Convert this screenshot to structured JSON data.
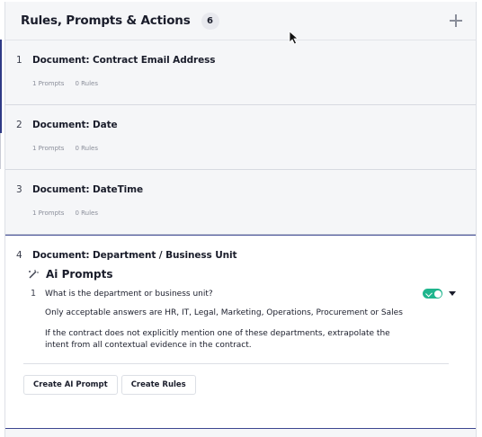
{
  "header": {
    "title": "Rules, Prompts & Actions",
    "count": "6"
  },
  "items": [
    {
      "number": "1",
      "title": "Document: Contract Email Address",
      "prompts": "1 Prompts",
      "rules": "0 Rules"
    },
    {
      "number": "2",
      "title": "Document: Date",
      "prompts": "1 Prompts",
      "rules": "0 Rules"
    },
    {
      "number": "3",
      "title": "Document: DateTime",
      "prompts": "1 Prompts",
      "rules": "0 Rules"
    },
    {
      "number": "4",
      "title": "Document: Department / Business Unit",
      "section_title": "Ai Prompts",
      "prompt": {
        "number": "1",
        "text": "What is the department or business unit?",
        "enabled": true,
        "detail_1": "Only acceptable answers are HR, IT, Legal, Marketing, Operations, Procurement or Sales",
        "detail_2": "If the contract does not explicitly mention one of these departments, extrapolate the intent from all contextual evidence in the contract."
      },
      "buttons": {
        "create_prompt": "Create AI Prompt",
        "create_rules": "Create Rules"
      }
    }
  ],
  "colors": {
    "accent": "#3c4690",
    "toggle_on": "#1fb58d"
  }
}
